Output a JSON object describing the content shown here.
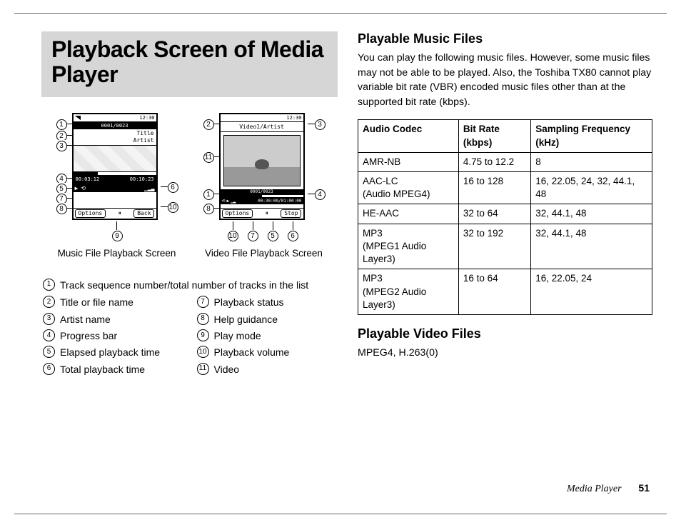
{
  "page_title": "Playback Screen of Media Player",
  "music_screen": {
    "caption": "Music File Playback Screen",
    "top_counter": "0001/0023",
    "title_label": "Title",
    "artist_label": "Artist",
    "elapsed": "00:03:12",
    "total": "00:10:23",
    "left_softkey": "Options",
    "right_softkey": "Back",
    "clock": "12:30"
  },
  "video_screen": {
    "caption": "Video File Playback Screen",
    "top_line": "Video1/Artist",
    "elapsed": "00:30:00",
    "total": "01:00:00",
    "left_softkey": "Options",
    "right_softkey": "Stop",
    "clock": "12:30"
  },
  "legend_full": "Track sequence number/total number of tracks in the list",
  "legend_left": [
    "Title or file name",
    "Artist name",
    "Progress bar",
    "Elapsed playback time",
    "Total playback time"
  ],
  "legend_right": [
    "Playback status",
    "Help guidance",
    "Play mode",
    "Playback volume",
    "Video"
  ],
  "right_col": {
    "h_music": "Playable Music Files",
    "music_text": "You can play the following music files. However, some music files may not be able to be played. Also, the Toshiba TX80 cannot play variable bit rate (VBR) encoded music files other than at the supported bit rate (kbps).",
    "table_headers": [
      "Audio Codec",
      "Bit Rate (kbps)",
      "Sampling Frequency (kHz)"
    ],
    "table_rows": [
      [
        "AMR-NB",
        "4.75 to 12.2",
        "8"
      ],
      [
        "AAC-LC\n(Audio MPEG4)",
        "16 to 128",
        "16, 22.05, 24, 32, 44.1, 48"
      ],
      [
        "HE-AAC",
        "32 to 64",
        "32, 44.1, 48"
      ],
      [
        "MP3\n(MPEG1 Audio Layer3)",
        "32 to 192",
        "32, 44.1, 48"
      ],
      [
        "MP3\n(MPEG2 Audio Layer3)",
        "16 to 64",
        "16, 22.05, 24"
      ]
    ],
    "h_video": "Playable Video Files",
    "video_text": "MPEG4, H.263(0)"
  },
  "footer_section": "Media Player",
  "footer_page": "51"
}
